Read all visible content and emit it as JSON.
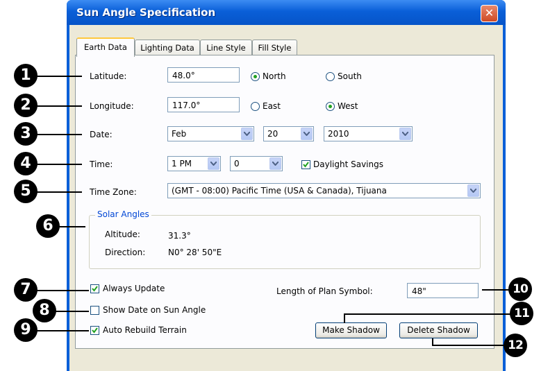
{
  "window": {
    "title": "Sun Angle Specification",
    "close_label": "✕"
  },
  "tabs": [
    "Earth Data",
    "Lighting Data",
    "Line Style",
    "Fill Style"
  ],
  "earth": {
    "latitude": {
      "label": "Latitude:",
      "value": "48.0°",
      "options": [
        "North",
        "South"
      ],
      "selected": "North"
    },
    "longitude": {
      "label": "Longitude:",
      "value": "117.0°",
      "options": [
        "East",
        "West"
      ],
      "selected": "West"
    },
    "date": {
      "label": "Date:",
      "month": "Feb",
      "day": "20",
      "year": "2010"
    },
    "time": {
      "label": "Time:",
      "hour": "1 PM",
      "minute": "0",
      "daylight_label": "Daylight Savings",
      "daylight_checked": true
    },
    "timezone": {
      "label": "Time Zone:",
      "value": "(GMT - 08:00) Pacific Time (USA & Canada), Tijuana"
    }
  },
  "solar": {
    "legend": "Solar Angles",
    "altitude_label": "Altitude:",
    "altitude_value": "31.3°",
    "direction_label": "Direction:",
    "direction_value": "N0° 28' 50\"E"
  },
  "options": {
    "always_update": "Always Update",
    "show_date": "Show Date on Sun Angle",
    "auto_rebuild": "Auto Rebuild Terrain",
    "always_update_checked": true,
    "show_date_checked": false,
    "auto_rebuild_checked": true
  },
  "plan_symbol": {
    "label": "Length of Plan Symbol:",
    "value": "48\""
  },
  "buttons": {
    "make_shadow": "Make Shadow",
    "delete_shadow": "Delete Shadow"
  },
  "callouts": [
    "1",
    "2",
    "3",
    "4",
    "5",
    "6",
    "7",
    "8",
    "9",
    "10",
    "11",
    "12"
  ],
  "colors": {
    "title_bar": "#0a5fd8",
    "dialog_bg": "#ece9d8",
    "radio_dot": "#21a121",
    "group_label": "#0046d5"
  }
}
